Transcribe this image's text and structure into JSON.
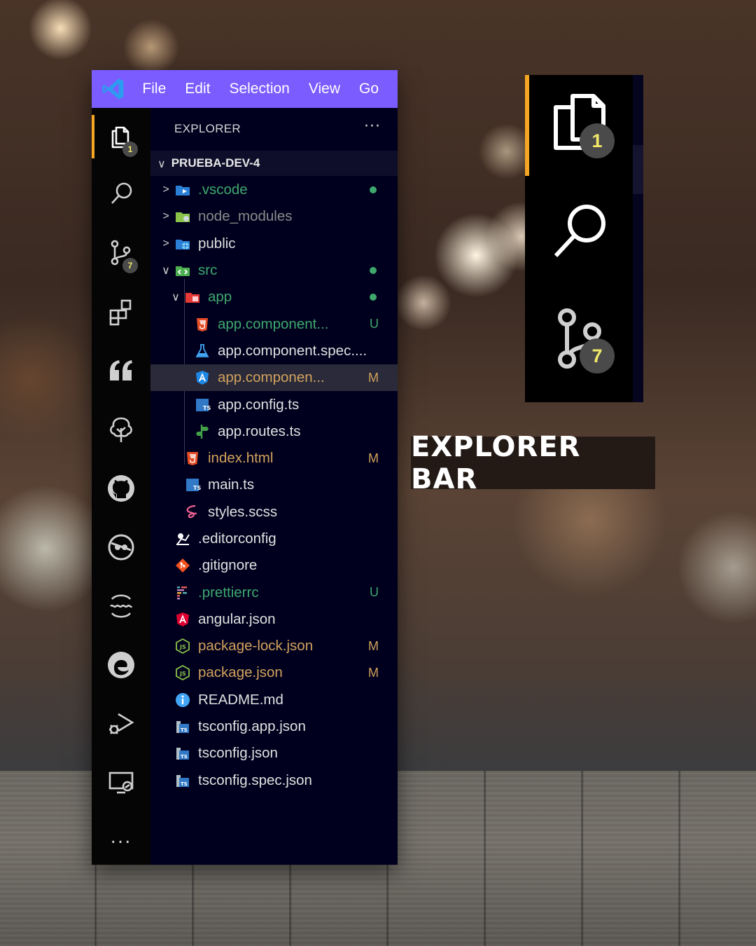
{
  "titlebar": {
    "menu": [
      "File",
      "Edit",
      "Selection",
      "View",
      "Go"
    ]
  },
  "activity_bar": {
    "items": [
      {
        "name": "explorer",
        "badge": "1",
        "active": true
      },
      {
        "name": "search"
      },
      {
        "name": "source-control",
        "badge": "7"
      },
      {
        "name": "extensions"
      },
      {
        "name": "quotes"
      },
      {
        "name": "tree"
      },
      {
        "name": "github"
      },
      {
        "name": "github-copilot"
      },
      {
        "name": "live-share"
      },
      {
        "name": "edge-devtools"
      },
      {
        "name": "run-and-debug"
      },
      {
        "name": "remote-explorer"
      },
      {
        "name": "more"
      }
    ],
    "more_label": "..."
  },
  "explorer": {
    "title": "EXPLORER",
    "more_label": "···",
    "project": "PRUEBA-DEV-4",
    "project_chevron": "∨",
    "tree": [
      {
        "label": ".vscode",
        "color": "#3ea86d",
        "depth": 1,
        "twisty": ">",
        "icon": "folder-vscode-icon",
        "dot": true
      },
      {
        "label": "node_modules",
        "color": "#8a8a8a",
        "depth": 1,
        "twisty": ">",
        "icon": "folder-node-icon"
      },
      {
        "label": "public",
        "color": "#e0e0e0",
        "depth": 1,
        "twisty": ">",
        "icon": "folder-public-icon"
      },
      {
        "label": "src",
        "color": "#3ea86d",
        "depth": 1,
        "twisty": "∨",
        "icon": "folder-src-icon",
        "dot": true
      },
      {
        "label": "app",
        "color": "#3ea86d",
        "depth": 2,
        "twisty": "∨",
        "icon": "folder-app-icon",
        "dot": true
      },
      {
        "label": "app.component...",
        "color": "#3ea86d",
        "depth": 3,
        "icon": "html-icon",
        "status": "U",
        "status_color": "#3ea86d"
      },
      {
        "label": "app.component.spec....",
        "color": "#e0e0e0",
        "depth": 3,
        "icon": "test-flask-icon"
      },
      {
        "label": "app.componen...",
        "color": "#d2a25c",
        "depth": 3,
        "icon": "angular-component-icon",
        "status": "M",
        "status_color": "#d2a25c",
        "selected": true
      },
      {
        "label": "app.config.ts",
        "color": "#e0e0e0",
        "depth": 3,
        "icon": "typescript-icon"
      },
      {
        "label": "app.routes.ts",
        "color": "#e0e0e0",
        "depth": 3,
        "icon": "routes-icon"
      },
      {
        "label": "index.html",
        "color": "#d2a25c",
        "depth": 2,
        "icon": "html-icon",
        "status": "M",
        "status_color": "#d2a25c"
      },
      {
        "label": "main.ts",
        "color": "#e0e0e0",
        "depth": 2,
        "icon": "typescript-icon"
      },
      {
        "label": "styles.scss",
        "color": "#e0e0e0",
        "depth": 2,
        "icon": "sass-icon"
      },
      {
        "label": ".editorconfig",
        "color": "#e0e0e0",
        "depth": 1,
        "icon": "editorconfig-icon"
      },
      {
        "label": ".gitignore",
        "color": "#e0e0e0",
        "depth": 1,
        "icon": "git-icon"
      },
      {
        "label": ".prettierrc",
        "color": "#3ea86d",
        "depth": 1,
        "icon": "prettier-icon",
        "status": "U",
        "status_color": "#3ea86d"
      },
      {
        "label": "angular.json",
        "color": "#e0e0e0",
        "depth": 1,
        "icon": "angular-icon"
      },
      {
        "label": "package-lock.json",
        "color": "#d2a25c",
        "depth": 1,
        "icon": "nodejs-icon",
        "status": "M",
        "status_color": "#d2a25c"
      },
      {
        "label": "package.json",
        "color": "#d2a25c",
        "depth": 1,
        "icon": "nodejs-icon",
        "status": "M",
        "status_color": "#d2a25c"
      },
      {
        "label": "README.md",
        "color": "#e0e0e0",
        "depth": 1,
        "icon": "info-icon"
      },
      {
        "label": "tsconfig.app.json",
        "color": "#e0e0e0",
        "depth": 1,
        "icon": "tsconfig-icon"
      },
      {
        "label": "tsconfig.json",
        "color": "#e0e0e0",
        "depth": 1,
        "icon": "tsconfig-icon"
      },
      {
        "label": "tsconfig.spec.json",
        "color": "#e0e0e0",
        "depth": 1,
        "icon": "tsconfig-icon"
      }
    ]
  },
  "zoom_panel": {
    "explorer_badge": "1",
    "source_control_badge": "7"
  },
  "caption": "EXPLORER BAR",
  "colors": {
    "titlebar": "#7a5cff",
    "accent": "#f5a623",
    "badge_text": "#f2e86a",
    "untracked": "#3ea86d",
    "modified": "#d2a25c"
  }
}
